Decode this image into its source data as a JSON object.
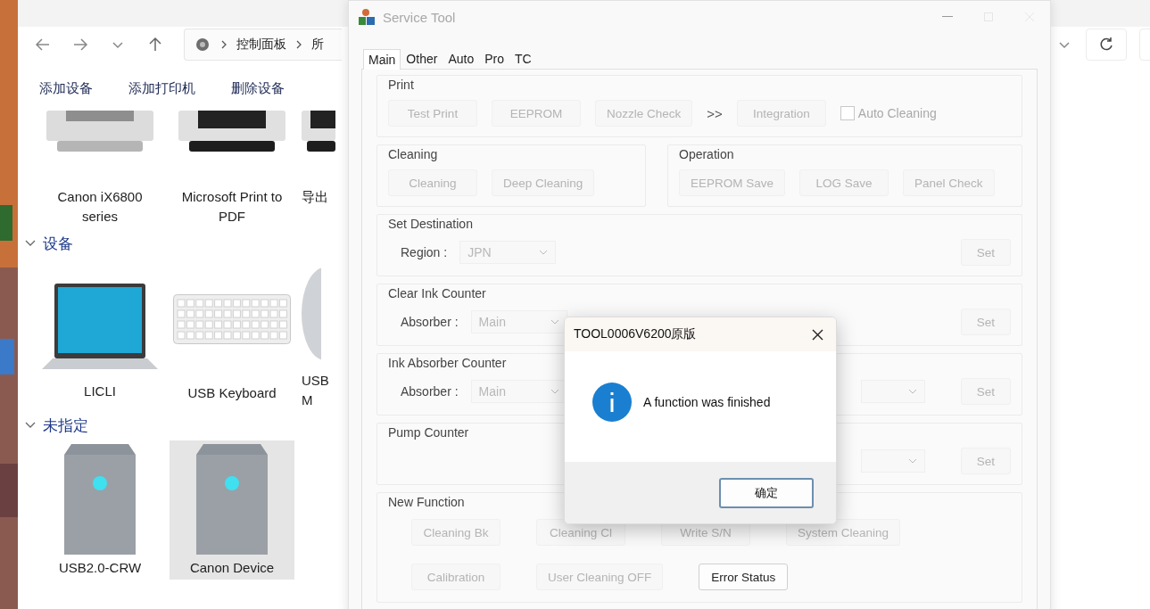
{
  "explorer": {
    "breadcrumb": [
      {
        "label": "控制面板"
      },
      {
        "label": "所"
      }
    ],
    "commands": [
      "添加设备",
      "添加打印机",
      "删除设备"
    ],
    "sections": [
      {
        "items": [
          {
            "kind": "printer",
            "label": "Canon iX6800 series",
            "selected": false
          },
          {
            "kind": "printer-dark",
            "label": "Microsoft Print to PDF",
            "selected": false
          },
          {
            "kind": "printer-dark",
            "label": "导出",
            "selected": false
          }
        ]
      },
      {
        "heading": "设备",
        "items": [
          {
            "kind": "laptop",
            "label": "LICLI",
            "selected": false
          },
          {
            "kind": "keyboard",
            "label": "USB Keyboard",
            "selected": false
          },
          {
            "kind": "mouse",
            "label": "USB M",
            "selected": false
          }
        ]
      },
      {
        "heading": "未指定",
        "items": [
          {
            "kind": "drive",
            "label": "USB2.0-CRW",
            "selected": false
          },
          {
            "kind": "drive",
            "label": "Canon Device",
            "selected": true
          }
        ]
      }
    ]
  },
  "service_tool": {
    "title": "Service Tool",
    "tabs": [
      {
        "label": "Main",
        "selected": true
      },
      {
        "label": "Other",
        "selected": false
      },
      {
        "label": "Auto",
        "selected": false
      },
      {
        "label": "Pro",
        "selected": false
      },
      {
        "label": "TC",
        "selected": false
      }
    ],
    "group_rows": [
      [
        {
          "title": "Print",
          "rows": [
            {
              "items": [
                {
                  "kind": "button",
                  "label": "Test Print",
                  "disabled": true
                },
                {
                  "kind": "button",
                  "label": "EEPROM",
                  "disabled": true
                },
                {
                  "kind": "button",
                  "label": "Nozzle Check",
                  "disabled": true
                },
                {
                  "kind": "text",
                  "label": ">>"
                },
                {
                  "kind": "button",
                  "label": "Integration",
                  "disabled": true
                },
                {
                  "kind": "checkbox",
                  "label": "Auto Cleaning",
                  "checked": false,
                  "disabled": true
                }
              ]
            }
          ]
        }
      ],
      [
        {
          "title": "Cleaning",
          "rows": [
            {
              "items": [
                {
                  "kind": "button",
                  "label": "Cleaning",
                  "disabled": true
                },
                {
                  "kind": "button",
                  "label": "Deep Cleaning",
                  "disabled": true
                }
              ]
            }
          ]
        },
        {
          "title": "Operation",
          "rows": [
            {
              "items": [
                {
                  "kind": "button",
                  "label": "EEPROM Save",
                  "disabled": true
                },
                {
                  "kind": "button",
                  "label": "LOG Save",
                  "disabled": true
                },
                {
                  "kind": "button",
                  "label": "Panel Check",
                  "disabled": true
                }
              ]
            }
          ]
        }
      ],
      [
        {
          "title": "Set Destination",
          "rows": [
            {
              "items": [
                {
                  "kind": "label",
                  "label": "Region :"
                },
                {
                  "kind": "select",
                  "value": "JPN",
                  "disabled": true
                }
              ],
              "trailing": [
                {
                  "kind": "button",
                  "label": "Set",
                  "disabled": true
                }
              ]
            }
          ]
        }
      ],
      [
        {
          "title": "Clear Ink Counter",
          "rows": [
            {
              "items": [
                {
                  "kind": "label",
                  "label": "Absorber :"
                },
                {
                  "kind": "select",
                  "value": "Main",
                  "disabled": true
                }
              ],
              "trailing": [
                {
                  "kind": "button",
                  "label": "Set",
                  "disabled": true
                }
              ]
            }
          ]
        }
      ],
      [
        {
          "title": "Ink Absorber Counter",
          "rows": [
            {
              "items": [
                {
                  "kind": "label",
                  "label": "Absorber :"
                },
                {
                  "kind": "select",
                  "value": "Main",
                  "disabled": true
                }
              ],
              "trailing": [
                {
                  "kind": "select",
                  "disabled": true
                },
                {
                  "kind": "button",
                  "label": "Set",
                  "disabled": true
                }
              ]
            }
          ]
        }
      ],
      [
        {
          "title": "Pump Counter",
          "rows": [
            {
              "items": [],
              "trailing": [
                {
                  "kind": "select",
                  "disabled": true
                },
                {
                  "kind": "button",
                  "label": "Set",
                  "disabled": true
                }
              ]
            }
          ]
        }
      ],
      [
        {
          "title": "New Function",
          "rows": [
            {
              "items": [
                {
                  "kind": "button",
                  "label": "Cleaning Bk",
                  "disabled": true
                },
                {
                  "kind": "button",
                  "label": "Cleaning Cl",
                  "disabled": true
                },
                {
                  "kind": "button",
                  "label": "Write S/N",
                  "disabled": true
                },
                {
                  "kind": "button",
                  "label": "System Cleaning",
                  "disabled": true
                }
              ]
            },
            {
              "items": [
                {
                  "kind": "button",
                  "label": "Calibration",
                  "disabled": true
                },
                {
                  "kind": "button",
                  "label": "User Cleaning OFF",
                  "disabled": true
                },
                {
                  "kind": "button",
                  "label": "Error Status",
                  "disabled": false
                }
              ]
            }
          ]
        }
      ]
    ]
  },
  "dialog": {
    "title": "TOOL0006V6200原版",
    "kind": "info",
    "message": "A function was finished",
    "button": "确定"
  }
}
